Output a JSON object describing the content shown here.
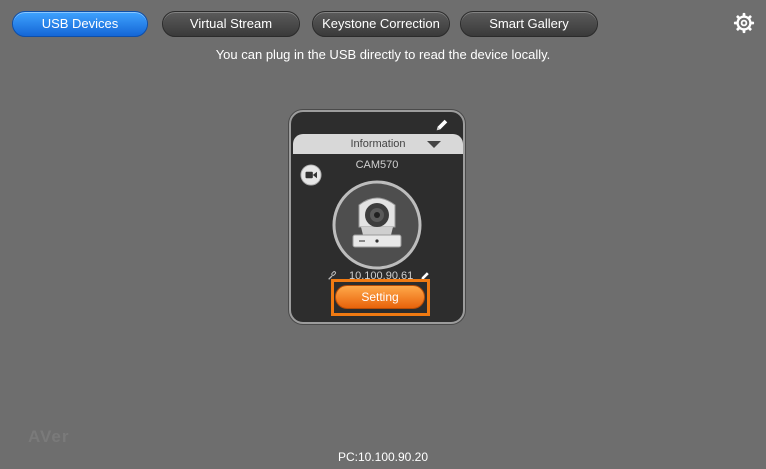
{
  "tabs": [
    {
      "label": "USB Devices",
      "active": true
    },
    {
      "label": "Virtual Stream",
      "active": false
    },
    {
      "label": "Keystone Correction",
      "active": false
    },
    {
      "label": "Smart Gallery",
      "active": false
    }
  ],
  "subtitle": "You can plug in the USB directly to read the device locally.",
  "device": {
    "info_label": "Information",
    "name": "CAM570",
    "ip": "10.100.90.61",
    "setting_label": "Setting"
  },
  "brand": "AVer",
  "footer": "PC:10.100.90.20",
  "colors": {
    "background": "#6e6e6e",
    "active_tab": "#1f7ae8",
    "setting_button": "#f58a24",
    "highlight": "#f07a12"
  },
  "icons": {
    "settings": "gear-icon",
    "edit": "pencil-icon",
    "video": "video-camera-icon",
    "link": "link-icon",
    "dropdown": "triangle-down-icon"
  }
}
